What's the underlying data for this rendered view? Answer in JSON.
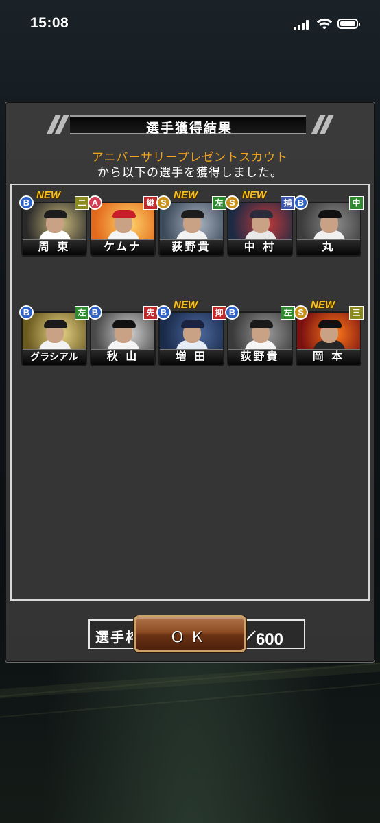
{
  "status_bar": {
    "time": "15:08"
  },
  "dialog": {
    "title": "選手獲得結果",
    "subtitle_highlight": "アニバーサリープレゼントスカウト",
    "subtitle_text": "から以下の選手を獲得しました。",
    "capacity_label": "選手枠：",
    "capacity_value": "581／600",
    "ok_label": "ＯＫ"
  },
  "players": [
    {
      "name": "周 東",
      "rank": "B",
      "position": "二",
      "is_new": true
    },
    {
      "name": "ケムナ",
      "rank": "A",
      "position": "継",
      "is_new": false
    },
    {
      "name": "荻野貴",
      "rank": "S",
      "position": "左",
      "is_new": true
    },
    {
      "name": "中 村",
      "rank": "S",
      "position": "捕",
      "is_new": true
    },
    {
      "name": "丸",
      "rank": "B",
      "position": "中",
      "is_new": false
    },
    {
      "name": "グラシアル",
      "rank": "B",
      "position": "左",
      "is_new": false
    },
    {
      "name": "秋 山",
      "rank": "B",
      "position": "先",
      "is_new": false
    },
    {
      "name": "増 田",
      "rank": "B",
      "position": "抑",
      "is_new": true
    },
    {
      "name": "荻野貴",
      "rank": "B",
      "position": "左",
      "is_new": false
    },
    {
      "name": "岡 本",
      "rank": "S",
      "position": "三",
      "is_new": true
    }
  ],
  "labels": {
    "new_badge": "NEW"
  },
  "colors": {
    "rank_B": "#2f63c8",
    "rank_A": "#d43a52",
    "rank_S": "#c7901a",
    "pos_infield": "#8b8a1e",
    "pos_outfield": "#2f8a2f",
    "pos_reliever": "#c0282a",
    "pos_catcher": "#3a56b0",
    "subtitle_accent": "#f0a41c"
  }
}
